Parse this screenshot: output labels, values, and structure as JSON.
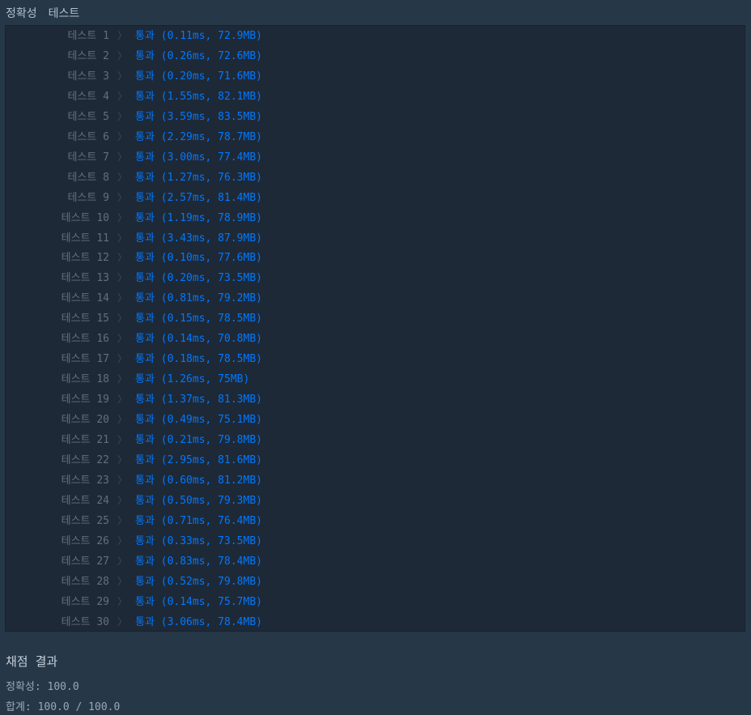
{
  "header": {
    "tab1": "정확성",
    "tab2": "테스트"
  },
  "tests": [
    {
      "label": "테스트 1",
      "result": "통과 (0.11ms, 72.9MB)"
    },
    {
      "label": "테스트 2",
      "result": "통과 (0.26ms, 72.6MB)"
    },
    {
      "label": "테스트 3",
      "result": "통과 (0.20ms, 71.6MB)"
    },
    {
      "label": "테스트 4",
      "result": "통과 (1.55ms, 82.1MB)"
    },
    {
      "label": "테스트 5",
      "result": "통과 (3.59ms, 83.5MB)"
    },
    {
      "label": "테스트 6",
      "result": "통과 (2.29ms, 78.7MB)"
    },
    {
      "label": "테스트 7",
      "result": "통과 (3.00ms, 77.4MB)"
    },
    {
      "label": "테스트 8",
      "result": "통과 (1.27ms, 76.3MB)"
    },
    {
      "label": "테스트 9",
      "result": "통과 (2.57ms, 81.4MB)"
    },
    {
      "label": "테스트 10",
      "result": "통과 (1.19ms, 78.9MB)"
    },
    {
      "label": "테스트 11",
      "result": "통과 (3.43ms, 87.9MB)"
    },
    {
      "label": "테스트 12",
      "result": "통과 (0.10ms, 77.6MB)"
    },
    {
      "label": "테스트 13",
      "result": "통과 (0.20ms, 73.5MB)"
    },
    {
      "label": "테스트 14",
      "result": "통과 (0.81ms, 79.2MB)"
    },
    {
      "label": "테스트 15",
      "result": "통과 (0.15ms, 78.5MB)"
    },
    {
      "label": "테스트 16",
      "result": "통과 (0.14ms, 70.8MB)"
    },
    {
      "label": "테스트 17",
      "result": "통과 (0.18ms, 78.5MB)"
    },
    {
      "label": "테스트 18",
      "result": "통과 (1.26ms, 75MB)"
    },
    {
      "label": "테스트 19",
      "result": "통과 (1.37ms, 81.3MB)"
    },
    {
      "label": "테스트 20",
      "result": "통과 (0.49ms, 75.1MB)"
    },
    {
      "label": "테스트 21",
      "result": "통과 (0.21ms, 79.8MB)"
    },
    {
      "label": "테스트 22",
      "result": "통과 (2.95ms, 81.6MB)"
    },
    {
      "label": "테스트 23",
      "result": "통과 (0.60ms, 81.2MB)"
    },
    {
      "label": "테스트 24",
      "result": "통과 (0.50ms, 79.3MB)"
    },
    {
      "label": "테스트 25",
      "result": "통과 (0.71ms, 76.4MB)"
    },
    {
      "label": "테스트 26",
      "result": "통과 (0.33ms, 73.5MB)"
    },
    {
      "label": "테스트 27",
      "result": "통과 (0.83ms, 78.4MB)"
    },
    {
      "label": "테스트 28",
      "result": "통과 (0.52ms, 79.8MB)"
    },
    {
      "label": "테스트 29",
      "result": "통과 (0.14ms, 75.7MB)"
    },
    {
      "label": "테스트 30",
      "result": "통과 (3.06ms, 78.4MB)"
    }
  ],
  "summary": {
    "title": "채점 결과",
    "accuracy": "정확성: 100.0",
    "total": "합계: 100.0 / 100.0"
  },
  "icons": {
    "row_separator": "chevron-right-icon"
  },
  "colors": {
    "background": "#263747",
    "panel": "#1e2937",
    "pass": "#0078ff",
    "label": "#5f7080"
  }
}
